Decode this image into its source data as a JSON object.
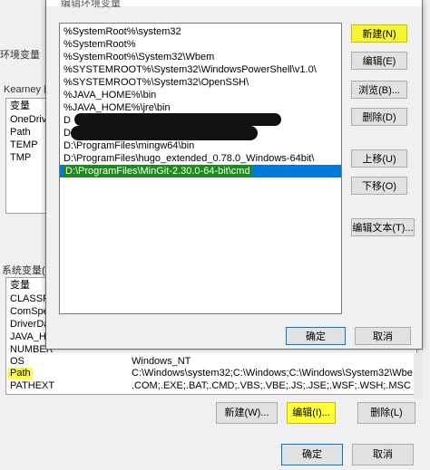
{
  "env_window": {
    "user_vars_label": "Kearney 的",
    "env_title_fragment": "环境变量",
    "user_vars_header": "变量",
    "user_vars": [
      "OneDrive",
      "Path",
      "TEMP",
      "TMP"
    ],
    "system_vars_label": "系统变量(S)",
    "system_header": "变量",
    "system_vars": [
      {
        "name": "CLASSPA",
        "value": ""
      },
      {
        "name": "ComSpec",
        "value": ""
      },
      {
        "name": "DriverDa",
        "value": ""
      },
      {
        "name": "JAVA_HO",
        "value": ""
      },
      {
        "name": "NUMBER",
        "value": ""
      },
      {
        "name": "OS",
        "value": "Windows_NT"
      },
      {
        "name": "Path",
        "value": "C:\\Windows\\system32;C:\\Windows;C:\\Windows\\System32\\Wbe..."
      },
      {
        "name": "PATHEXT",
        "value": ".COM;.EXE;.BAT;.CMD;.VBS;.VBE;.JS;.JSE;.WSF;.WSH;.MSC"
      }
    ],
    "new_btn": "新建(W)...",
    "edit_btn": "编辑(I)...",
    "delete_btn": "删除(L)",
    "ok_btn": "确定",
    "cancel_btn": "取消"
  },
  "edit_dialog": {
    "title": "编辑环境变量",
    "entries": [
      "%SystemRoot%\\system32",
      "%SystemRoot%",
      "%SystemRoot%\\System32\\Wbem",
      "%SYSTEMROOT%\\System32\\WindowsPowerShell\\v1.0\\",
      "%SYSTEMROOT%\\System32\\OpenSSH\\",
      "%JAVA_HOME%\\bin",
      "%JAVA_HOME%\\jre\\bin",
      "D",
      "D",
      "D:\\ProgramFiles\\mingw64\\bin",
      "D:\\ProgramFiles\\hugo_extended_0.78.0_Windows-64bit\\",
      "D:\\ProgramFiles\\MinGit-2.30.0-64-bit\\cmd"
    ],
    "buttons": {
      "new": "新建(N)",
      "edit": "编辑(E)",
      "browse": "浏览(B)...",
      "delete": "删除(D)",
      "move_up": "上移(U)",
      "move_down": "下移(O)",
      "edit_text": "编辑文本(T)..."
    },
    "ok": "确定",
    "cancel": "取消"
  }
}
